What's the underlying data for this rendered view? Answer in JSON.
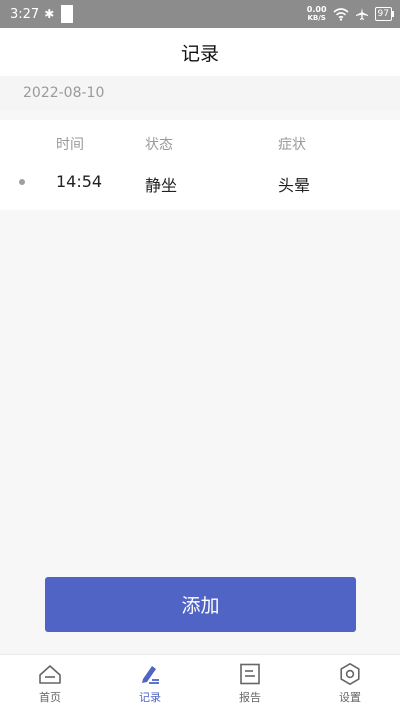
{
  "status_bar": {
    "time": "3:27",
    "net_speed_value": "0.00",
    "net_speed_unit": "KB/S",
    "battery": "97"
  },
  "header": {
    "title": "记录"
  },
  "record_group": {
    "date": "2022-08-10",
    "columns": {
      "time": "时间",
      "state": "状态",
      "symptom": "症状"
    },
    "rows": [
      {
        "time": "14:54",
        "state": "静坐",
        "symptom": "头晕"
      }
    ]
  },
  "actions": {
    "add_label": "添加"
  },
  "tab_bar": {
    "items": [
      {
        "label": "首页",
        "icon": "home-icon",
        "active": false
      },
      {
        "label": "记录",
        "icon": "pen-icon",
        "active": true
      },
      {
        "label": "报告",
        "icon": "report-icon",
        "active": false
      },
      {
        "label": "设置",
        "icon": "gear-icon",
        "active": false
      }
    ]
  },
  "colors": {
    "accent": "#4f64c5",
    "status_bar": "#8c8c8c"
  }
}
